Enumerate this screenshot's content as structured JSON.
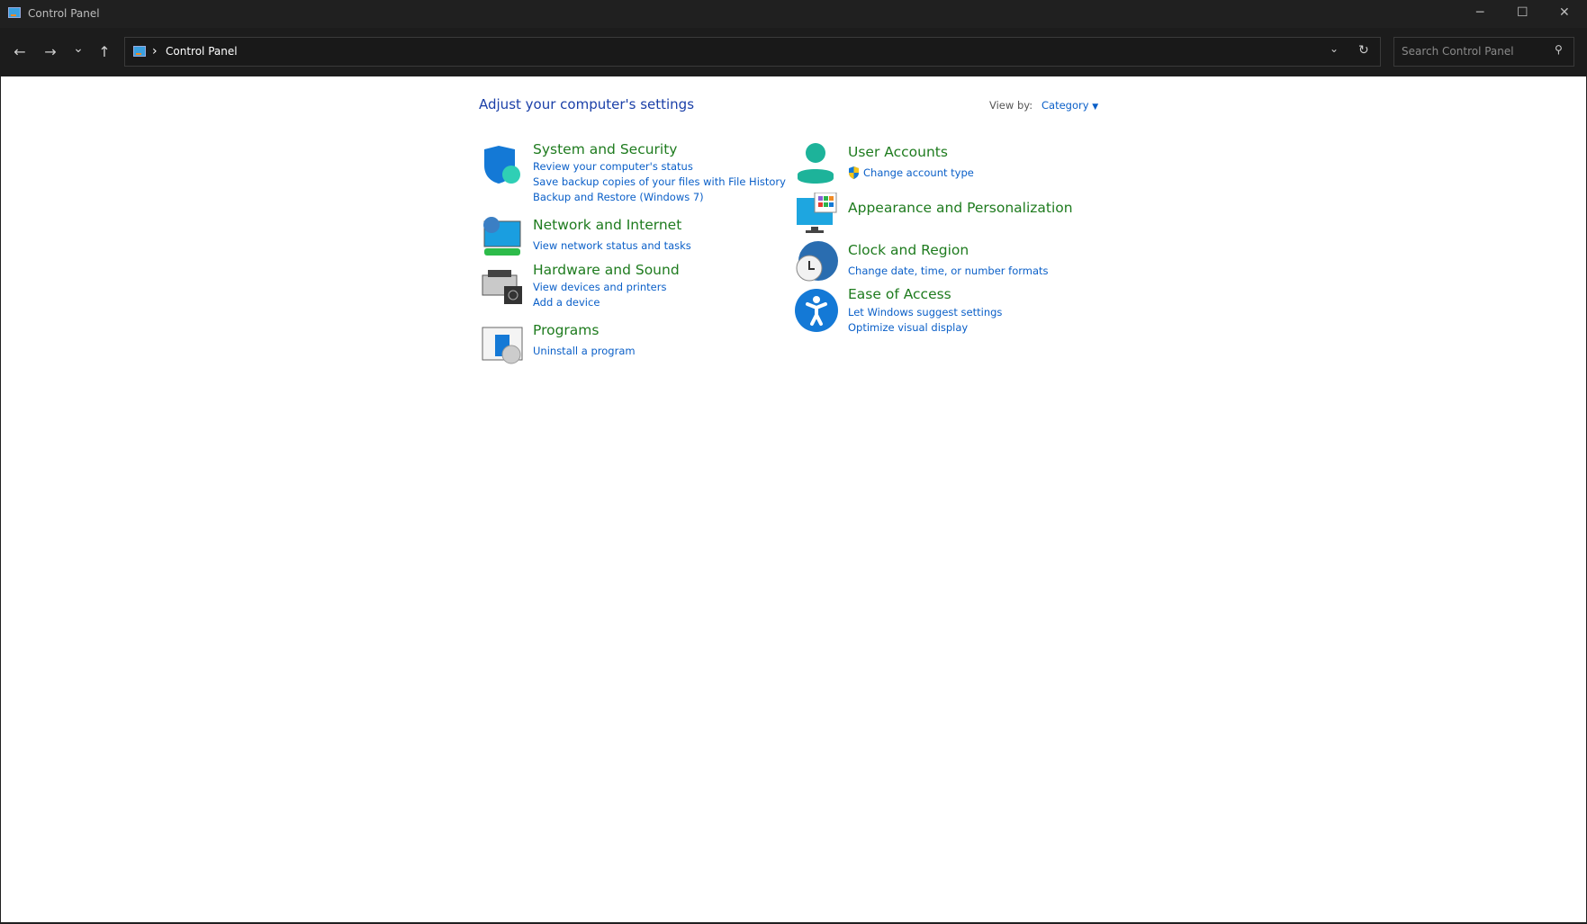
{
  "window": {
    "title": "Control Panel",
    "minimize": "─",
    "maximize": "☐",
    "close": "✕"
  },
  "nav": {
    "back": "←",
    "forward": "→",
    "recent": "⌄",
    "up": "↑",
    "breadcrumb_sep": "›",
    "breadcrumb": "Control Panel",
    "dropdown": "⌄",
    "refresh": "↻",
    "search_placeholder": "Search Control Panel",
    "search_icon": "⚲"
  },
  "main": {
    "heading": "Adjust your computer's settings",
    "view_by_label": "View by:",
    "view_by_value": "Category",
    "categories": [
      {
        "title": "System and Security",
        "links": [
          "Review your computer's status",
          "Save backup copies of your files with File History",
          "Backup and Restore (Windows 7)"
        ]
      },
      {
        "title": "Network and Internet",
        "links": [
          "View network status and tasks"
        ]
      },
      {
        "title": "Hardware and Sound",
        "links": [
          "View devices and printers",
          "Add a device"
        ]
      },
      {
        "title": "Programs",
        "links": [
          "Uninstall a program"
        ]
      },
      {
        "title": "User Accounts",
        "links": [
          "Change account type"
        ]
      },
      {
        "title": "Appearance and Personalization",
        "links": []
      },
      {
        "title": "Clock and Region",
        "links": [
          "Change date, time, or number formats"
        ]
      },
      {
        "title": "Ease of Access",
        "links": [
          "Let Windows suggest settings",
          "Optimize visual display"
        ]
      }
    ]
  }
}
